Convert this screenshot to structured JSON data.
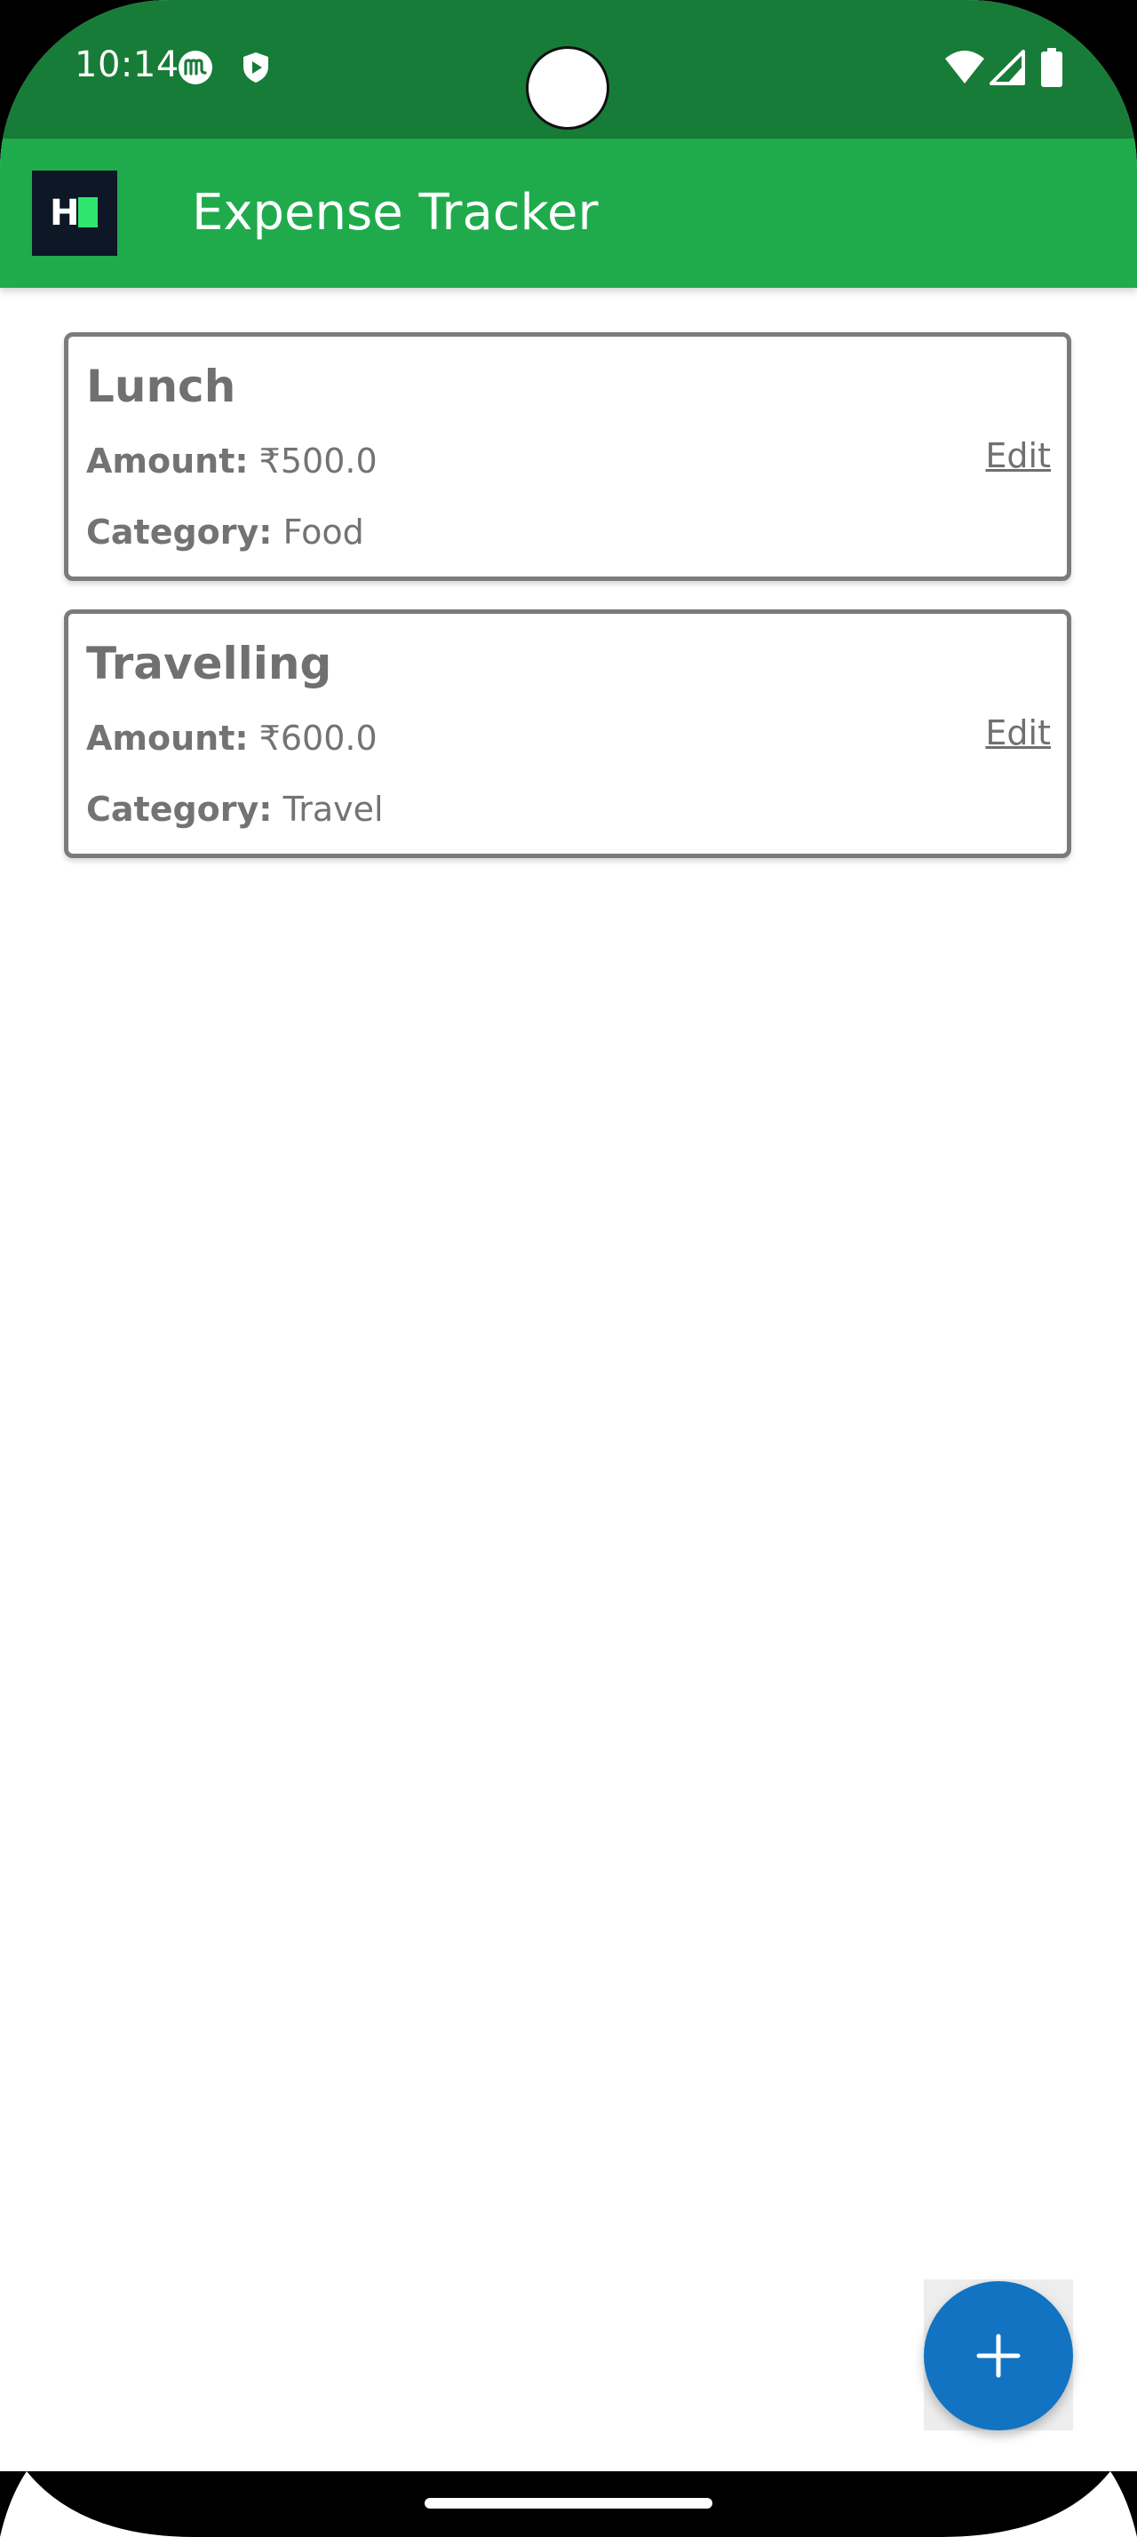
{
  "status_bar": {
    "time": "10:14",
    "left_icons": [
      "m-badge-icon",
      "shield-play-icon"
    ],
    "right_icons": [
      "wifi-icon",
      "cellular-signal-icon",
      "battery-icon"
    ]
  },
  "app_bar": {
    "logo_letter": "H",
    "title": "Expense Tracker"
  },
  "expenses": [
    {
      "title": "Lunch",
      "amount_label": "Amount:",
      "amount_value": "₹500.0",
      "category_label": "Category:",
      "category_value": "Food",
      "edit_label": "Edit"
    },
    {
      "title": "Travelling",
      "amount_label": "Amount:",
      "amount_value": "₹600.0",
      "category_label": "Category:",
      "category_value": "Travel",
      "edit_label": "Edit"
    }
  ],
  "fab": {
    "icon": "plus-icon"
  },
  "colors": {
    "status_bar": "#177c37",
    "app_bar": "#1fab4c",
    "fab": "#1173c2",
    "card_border": "#7b7b7b",
    "text_grey": "#707070"
  }
}
